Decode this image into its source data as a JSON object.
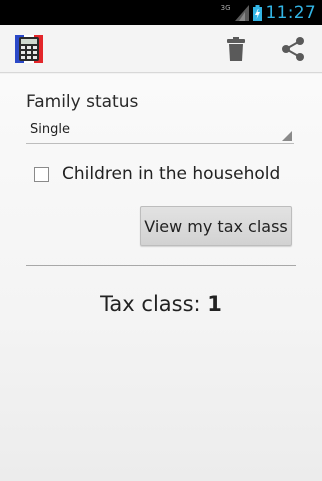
{
  "status_bar": {
    "network": "3G",
    "time": "11:27",
    "clock_color": "#33b5e5"
  },
  "action_bar": {
    "app_icon": "calculator-icon",
    "delete_icon": "trash-icon",
    "share_icon": "share-icon"
  },
  "form": {
    "family_status_label": "Family status",
    "family_status_value": "Single",
    "children_label": "Children in the household",
    "children_checked": false,
    "view_button_label": "View my tax class"
  },
  "result": {
    "label": "Tax class: ",
    "value": "1"
  }
}
